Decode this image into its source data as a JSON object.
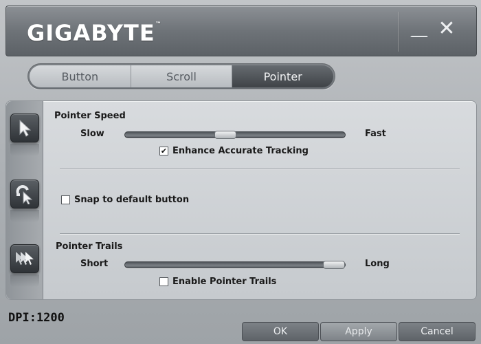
{
  "header": {
    "logo_text": "GIGABYTE",
    "trademark": "™"
  },
  "window_controls": {
    "minimize_icon": "minimize-icon",
    "close_icon": "close-icon",
    "close_glyph": "✕"
  },
  "tabs": [
    {
      "label": "Button",
      "active": false
    },
    {
      "label": "Scroll",
      "active": false
    },
    {
      "label": "Pointer",
      "active": true
    }
  ],
  "sidebar": [
    {
      "icon": "pointer-arrow-icon"
    },
    {
      "icon": "snap-magnet-icon"
    },
    {
      "icon": "pointer-trails-icon"
    }
  ],
  "pointer_speed": {
    "title": "Pointer Speed",
    "min_label": "Slow",
    "max_label": "Fast",
    "value_fraction": 0.45,
    "enhance_label": "Enhance Accurate Tracking",
    "enhance_checked": true
  },
  "snap": {
    "label": "Snap to default button",
    "checked": false
  },
  "pointer_trails": {
    "title": "Pointer Trails",
    "min_label": "Short",
    "max_label": "Long",
    "value_fraction": 1.0,
    "enable_label": "Enable Pointer Trails",
    "enable_checked": false
  },
  "footer": {
    "dpi_text": "DPI:1200",
    "ok_label": "OK",
    "apply_label": "Apply",
    "cancel_label": "Cancel"
  },
  "colors": {
    "active_tab": "#4a4e52",
    "panel_bg": "#d0d3d6"
  }
}
